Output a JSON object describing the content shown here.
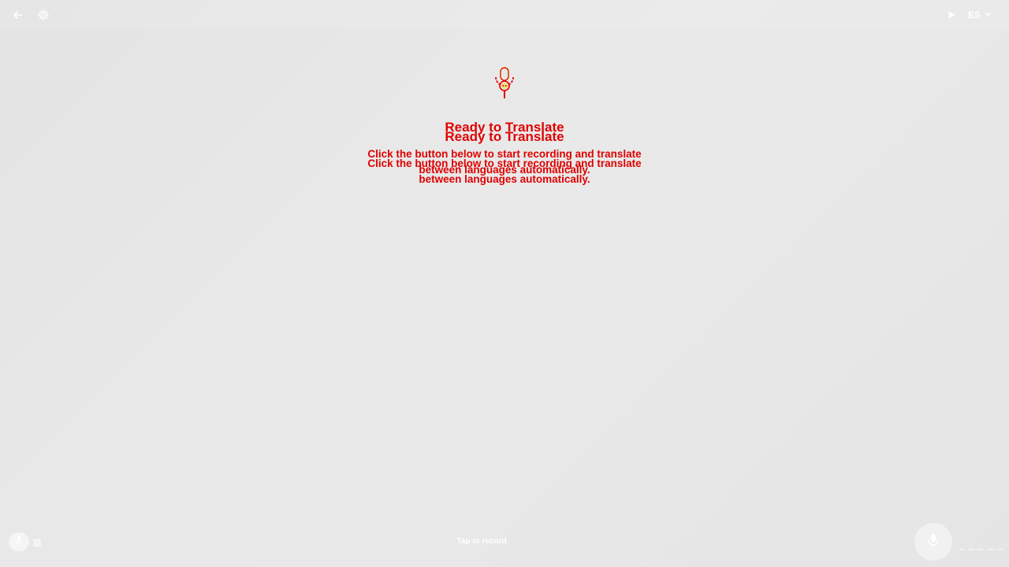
{
  "header": {
    "back_icon": "arrow-left-icon",
    "settings_icon": "gear-icon",
    "swap_icon": "send-arrow-icon",
    "target_language": "ES",
    "language_dropdown_icon": "chevron-down-icon"
  },
  "hero": {
    "icon": "microphone-icon",
    "title": "Ready to Translate",
    "description_line1": "Click the button below to start recording and translate",
    "description_line2": "between languages automatically."
  },
  "footer": {
    "mode_icon": "microphone-icon",
    "mode_alt_icon": "grid-icon",
    "tap_label": "Tap to record",
    "record_icon": "microphone-icon"
  },
  "colors": {
    "background": "#e6e6e6",
    "accent_red": "#e00000",
    "accent_yellow": "#f0e000",
    "icon_white": "#ffffff"
  }
}
